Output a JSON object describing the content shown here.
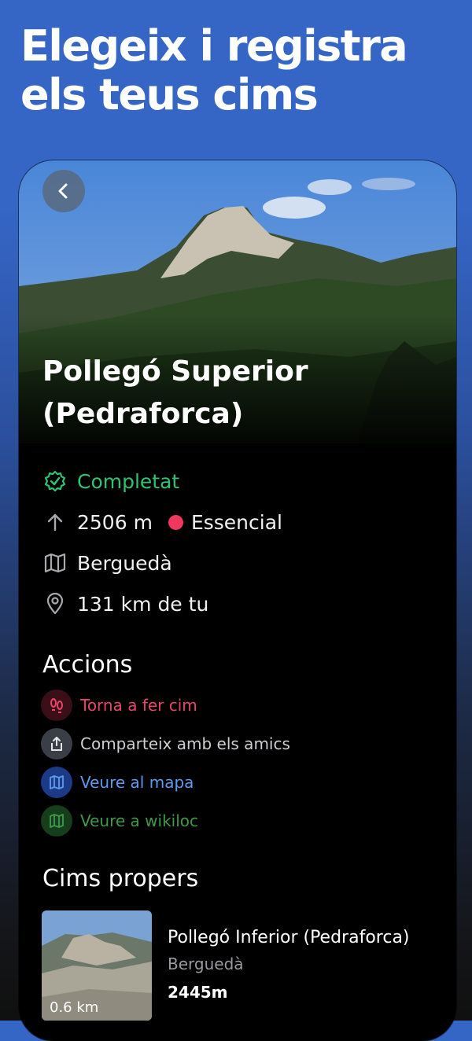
{
  "headline": "Elegeix i registra els teus cims",
  "peak": {
    "title_line1": "Pollegó Superior",
    "title_line2": "(Pedraforca)",
    "status": "Completat",
    "altitude": "2506 m",
    "category": "Essencial",
    "region": "Berguedà",
    "distance": "131 km de tu"
  },
  "actions_title": "Accions",
  "actions": [
    {
      "label": "Torna a fer cim",
      "icon": "footprints-icon"
    },
    {
      "label": "Comparteix amb els amics",
      "icon": "share-icon"
    },
    {
      "label": "Veure al mapa",
      "icon": "map-icon"
    },
    {
      "label": "Veure a wikiloc",
      "icon": "map-icon"
    }
  ],
  "nearby_title": "Cims propers",
  "nearby": [
    {
      "name": "Pollegó Inferior (Pedraforca)",
      "region": "Berguedà",
      "altitude": "2445m",
      "distance": "0.6 km"
    }
  ],
  "colors": {
    "status_green": "#2fc273",
    "category_pink": "#f0385e",
    "accent_blue": "#5b9bf0",
    "wikiloc_green": "#3f9a48"
  }
}
